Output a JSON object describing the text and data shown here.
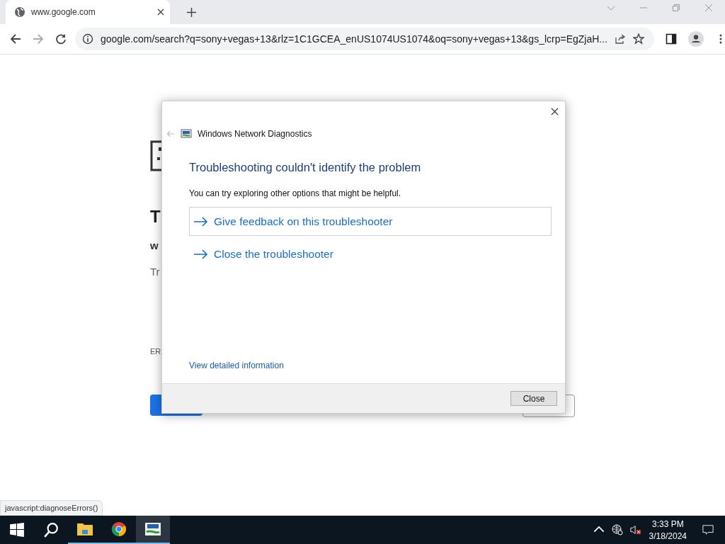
{
  "browser": {
    "tabs": [
      {
        "title": "www.google.com",
        "selected": true
      }
    ],
    "address": "google.com/search?q=sony+vegas+13&rlz=1C1GCEA_enUS1074US1074&oq=sony+vegas+13&gs_lcrp=EgZjaH..."
  },
  "page_fragments": [
    {
      "kind": "heading",
      "text": "T"
    },
    {
      "kind": "bold",
      "text": "w"
    },
    {
      "kind": "body",
      "text": "Tr"
    },
    {
      "kind": "code",
      "text": "ER"
    }
  ],
  "dialog": {
    "title": "Windows Network Diagnostics",
    "heading": "Troubleshooting couldn't identify the problem",
    "message": "You can try exploring other options that might be helpful.",
    "options": [
      {
        "label": "Give feedback on this troubleshooter",
        "selected": true
      },
      {
        "label": "Close the troubleshooter",
        "selected": false
      }
    ],
    "link": "View detailed information",
    "button": "Close"
  },
  "status_bubble": "javascript:diagnoseErrors()",
  "taskbar": {
    "apps": [
      {
        "kind": "folder",
        "selected": false
      },
      {
        "kind": "chrome",
        "selected": false
      },
      {
        "kind": "diagnostics",
        "selected": true
      }
    ],
    "time": "3:33 PM",
    "date": "3/18/2024"
  }
}
